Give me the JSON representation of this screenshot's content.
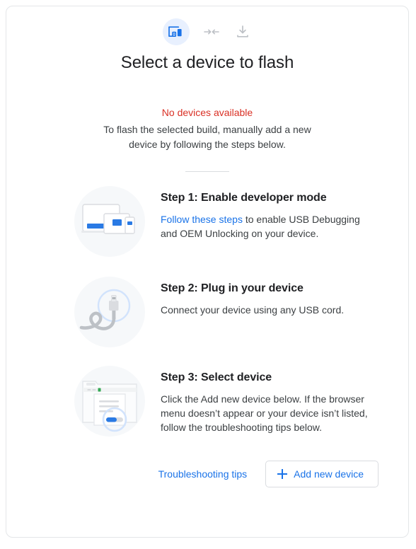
{
  "dialog": {
    "title": "Select a device to flash",
    "header_icons": [
      {
        "name": "devices-icon",
        "state": "active"
      },
      {
        "name": "merge-arrows-icon",
        "state": "inactive"
      },
      {
        "name": "download-icon",
        "state": "inactive"
      }
    ],
    "status": {
      "message": "No devices available",
      "message_color": "#d93025",
      "description": "To flash the selected build, manually add a new device by following the steps below."
    },
    "steps": [
      {
        "title": "Step 1: Enable developer mode",
        "illustration": "devices-illustration",
        "text_link": "Follow these steps",
        "text_rest": " to enable USB Debugging and OEM Unlocking on your device."
      },
      {
        "title": "Step 2: Plug in your device",
        "illustration": "usb-cable-illustration",
        "text": "Connect your device using any USB cord."
      },
      {
        "title": "Step 3: Select device",
        "illustration": "browser-document-illustration",
        "text": "Click the Add new device below. If the browser menu doesn’t appear or your device isn’t listed, follow the troubleshooting tips below."
      }
    ],
    "footer": {
      "troubleshooting_label": "Troubleshooting tips",
      "add_device_label": "Add new device",
      "add_device_icon": "plus-icon"
    },
    "colors": {
      "accent": "#1a73e8",
      "error": "#d93025",
      "text_primary": "#202124",
      "text_secondary": "#3c4043",
      "card_border": "#e4e6e8",
      "art_bg": "#f6f8fa",
      "chip_bg": "#e8f0fe"
    }
  }
}
